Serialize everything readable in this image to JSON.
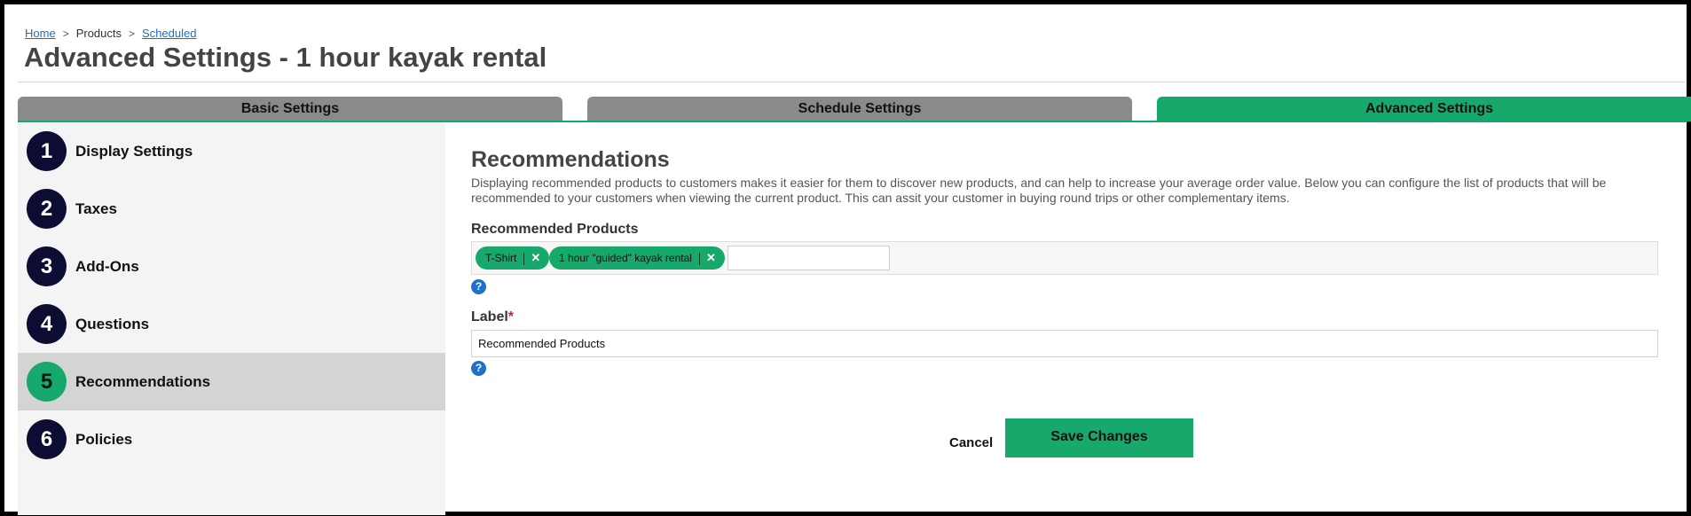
{
  "breadcrumb": {
    "home": "Home",
    "sep": ">",
    "products": "Products",
    "scheduled": "Scheduled"
  },
  "page_title": "Advanced Settings - 1 hour kayak rental",
  "tabs": [
    {
      "label": "Basic Settings"
    },
    {
      "label": "Schedule Settings"
    },
    {
      "label": "Advanced Settings",
      "active": true
    }
  ],
  "sidebar": {
    "items": [
      {
        "number": "1",
        "label": "Display Settings"
      },
      {
        "number": "2",
        "label": "Taxes"
      },
      {
        "number": "3",
        "label": "Add-Ons"
      },
      {
        "number": "4",
        "label": "Questions"
      },
      {
        "number": "5",
        "label": "Recommendations",
        "active": true
      },
      {
        "number": "6",
        "label": "Policies"
      }
    ]
  },
  "main": {
    "title": "Recommendations",
    "description": "Displaying recommended products to customers makes it easier for them to discover new products, and can help to increase your average order value. Below you can configure the list of products that will be recommended to your customers when viewing the current product. This can assit your customer in buying round trips or other complementary items.",
    "recommended_products": {
      "label": "Recommended Products",
      "tags": [
        {
          "label": "T-Shirt"
        },
        {
          "label": "1 hour \"guided\" kayak rental"
        }
      ],
      "input_value": ""
    },
    "label_field": {
      "label": "Label",
      "required_mark": "*",
      "value": "Recommended Products"
    },
    "help_icon": "?",
    "remove_icon": "✕",
    "cancel_label": "Cancel",
    "save_label": "Save Changes"
  },
  "colors": {
    "accent": "#17a86b",
    "tab_inactive": "#8a8a8a",
    "step_circle": "#0d0d33",
    "link": "#1a6fc9",
    "help": "#1a73c9"
  }
}
